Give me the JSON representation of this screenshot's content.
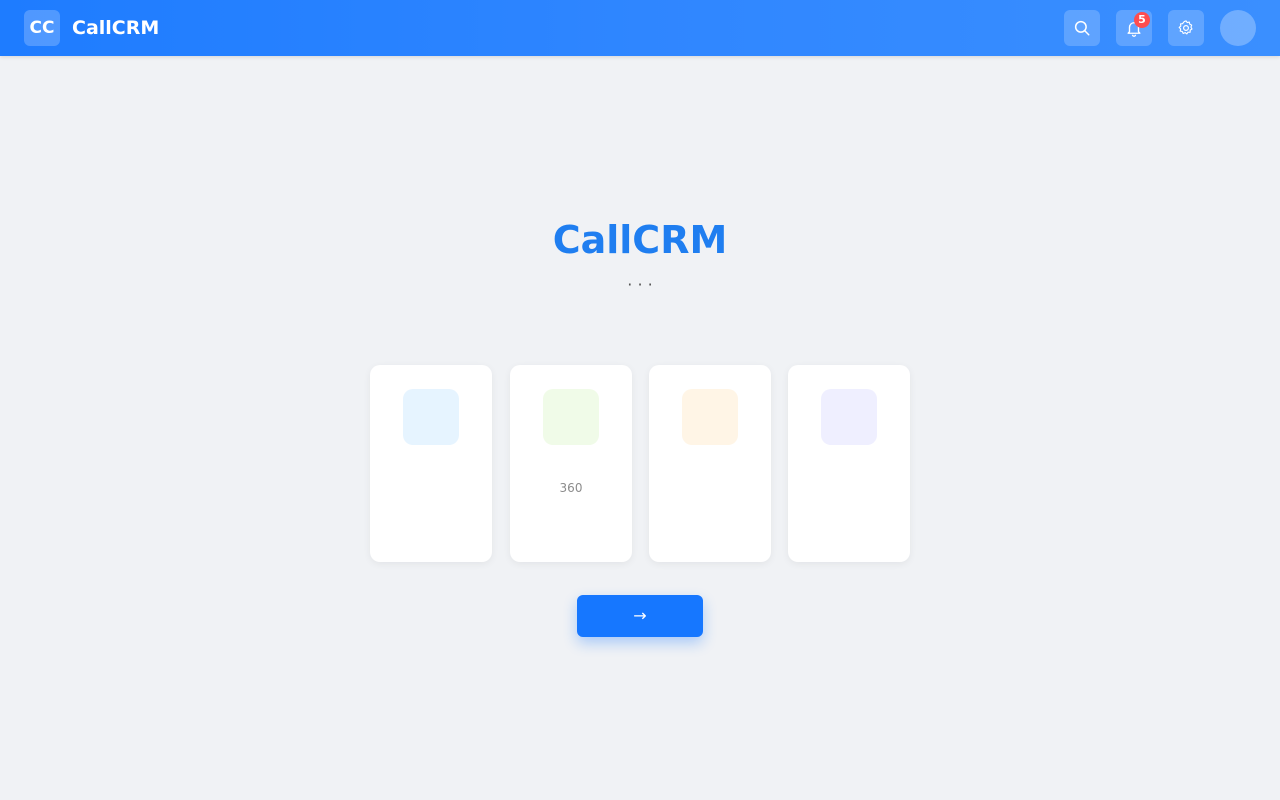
{
  "header": {
    "logo_text": "CC",
    "app_name": "CallCRM",
    "search_icon": "search-icon",
    "notifications": {
      "icon": "bell-icon",
      "count": "5"
    },
    "settings_icon": "gear-icon",
    "avatar_glyph": "",
    "accent": "#1e7cff"
  },
  "hero": {
    "title": "CallCRM ",
    "subtitle_line1": " ·  ·  · ",
    "subtitle_line2": ""
  },
  "features": [
    {
      "icon": "",
      "icon_bg": "#e6f4ff",
      "title": "",
      "desc": ""
    },
    {
      "icon": "",
      "icon_bg": "#f0fbe8",
      "title": "",
      "desc": "360"
    },
    {
      "icon": "",
      "icon_bg": "#fff5e6",
      "title": "",
      "desc": ""
    },
    {
      "icon": "",
      "icon_bg": "#efefff",
      "title": "",
      "desc": ""
    }
  ],
  "cta": {
    "label": " →",
    "color": "#1677ff"
  }
}
